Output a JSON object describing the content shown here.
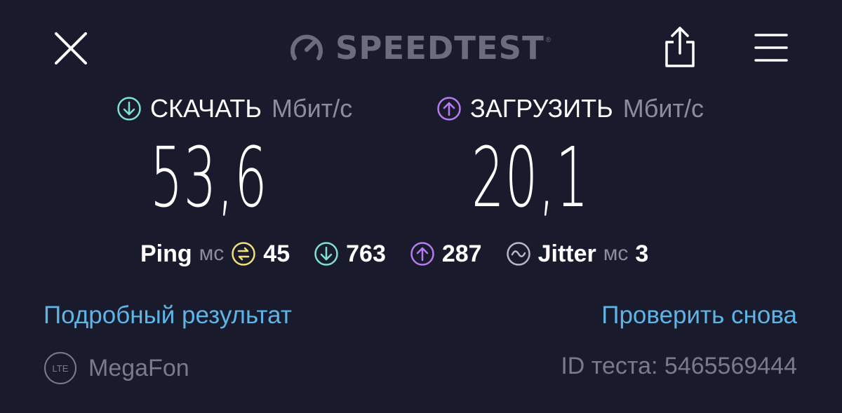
{
  "app": {
    "logo_text": "SPEEDTEST",
    "logo_trademark": "®"
  },
  "toolbar": {
    "close_icon": "close-icon",
    "share_icon": "share-icon",
    "menu_icon": "menu-icon"
  },
  "download": {
    "label": "СКАЧАТЬ",
    "unit": "Мбит/с",
    "value": "53,6",
    "color": "#7fe0d4"
  },
  "upload": {
    "label": "ЗАГРУЗИТЬ",
    "unit": "Мбит/с",
    "value": "20,1",
    "color": "#b57cf2"
  },
  "ping": {
    "label": "Ping",
    "unit": "мс",
    "idle_value": "45",
    "download_value": "763",
    "upload_value": "287",
    "idle_color": "#f0e07a"
  },
  "jitter": {
    "label": "Jitter",
    "unit": "мс",
    "value": "3"
  },
  "links": {
    "details": "Подробный результат",
    "retest": "Проверить снова",
    "color": "#5fb4e6"
  },
  "footer": {
    "network_badge": "LTE",
    "provider": "MegaFon",
    "test_id_label": "ID теста:",
    "test_id_value": "5465569444"
  }
}
